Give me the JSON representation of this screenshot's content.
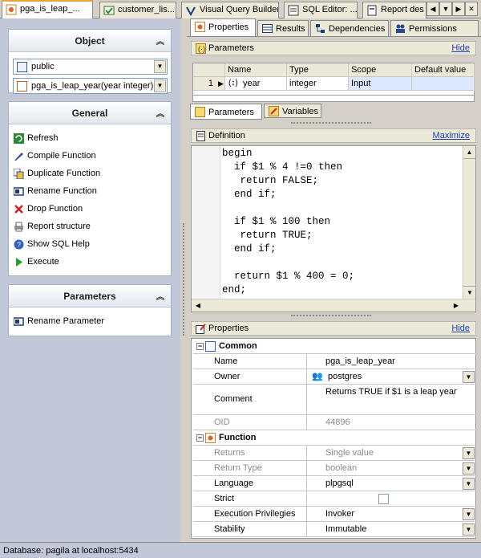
{
  "doc_tabs": [
    {
      "label": "pga_is_leap_...",
      "icon": "function-icon",
      "active": true
    },
    {
      "label": "customer_lis...",
      "icon": "view-icon",
      "active": false
    },
    {
      "label": "Visual Query Builder",
      "icon": "query-builder-icon",
      "active": false
    },
    {
      "label": "SQL Editor: ...",
      "icon": "sql-editor-icon",
      "active": false
    },
    {
      "label": "Report des",
      "icon": "report-icon",
      "active": false
    }
  ],
  "left": {
    "object_panel": {
      "title": "Object",
      "schema_value": "public",
      "function_value": "pga_is_leap_year(year integer)"
    },
    "general_panel": {
      "title": "General",
      "items": [
        {
          "label": "Refresh",
          "icon": "refresh-icon"
        },
        {
          "label": "Compile Function",
          "icon": "compile-icon"
        },
        {
          "label": "Duplicate Function",
          "icon": "duplicate-icon"
        },
        {
          "label": "Rename Function",
          "icon": "rename-icon"
        },
        {
          "label": "Drop Function",
          "icon": "drop-icon"
        },
        {
          "label": "Report structure",
          "icon": "printer-icon"
        },
        {
          "label": "Show SQL Help",
          "icon": "help-icon"
        },
        {
          "label": "Execute",
          "icon": "execute-icon"
        }
      ]
    },
    "parameters_panel": {
      "title": "Parameters",
      "items": [
        {
          "label": "Rename Parameter",
          "icon": "rename-icon"
        }
      ]
    }
  },
  "sub_tabs": [
    {
      "label": "Properties",
      "icon": "properties-icon",
      "active": true
    },
    {
      "label": "Results",
      "icon": "results-icon",
      "active": false
    },
    {
      "label": "Dependencies",
      "icon": "dependencies-icon",
      "active": false
    },
    {
      "label": "Permissions",
      "icon": "permissions-icon",
      "active": false
    }
  ],
  "parameters_section": {
    "title": "Parameters",
    "hide_label": "Hide",
    "columns": [
      "Name",
      "Type",
      "Scope",
      "Default value"
    ],
    "rows": [
      {
        "num": "1",
        "name": "year",
        "type": "integer",
        "scope": "Input",
        "default": ""
      }
    ],
    "inner_tabs": [
      "Parameters",
      "Variables"
    ]
  },
  "definition_section": {
    "title": "Definition",
    "maximize_label": "Maximize",
    "code": "begin\n  if $1 % 4 !=0 then\n   return FALSE;\n  end if;\n\n  if $1 % 100 then\n   return TRUE;\n  end if;\n\n  return $1 % 400 = 0;\nend;"
  },
  "properties_section": {
    "title": "Properties",
    "hide_label": "Hide",
    "groups": {
      "common": {
        "title": "Common",
        "name_label": "Name",
        "name_value": "pga_is_leap_year",
        "owner_label": "Owner",
        "owner_value": "postgres",
        "comment_label": "Comment",
        "comment_value": "Returns TRUE if $1 is a leap year",
        "oid_label": "OID",
        "oid_value": "44896"
      },
      "function": {
        "title": "Function",
        "returns_label": "Returns",
        "returns_value": "Single value",
        "return_type_label": "Return Type",
        "return_type_value": "boolean",
        "language_label": "Language",
        "language_value": "plpgsql",
        "strict_label": "Strict",
        "strict_checked": false,
        "exec_priv_label": "Execution Privilegies",
        "exec_priv_value": "Invoker",
        "stability_label": "Stability",
        "stability_value": "Immutable"
      }
    }
  },
  "statusbar": {
    "text": "Database: pagila at localhost:5434"
  },
  "colors": {
    "accent_tab": "#e8a33a",
    "link": "#1a3eb8",
    "left_bg": "#c3c8d8"
  }
}
